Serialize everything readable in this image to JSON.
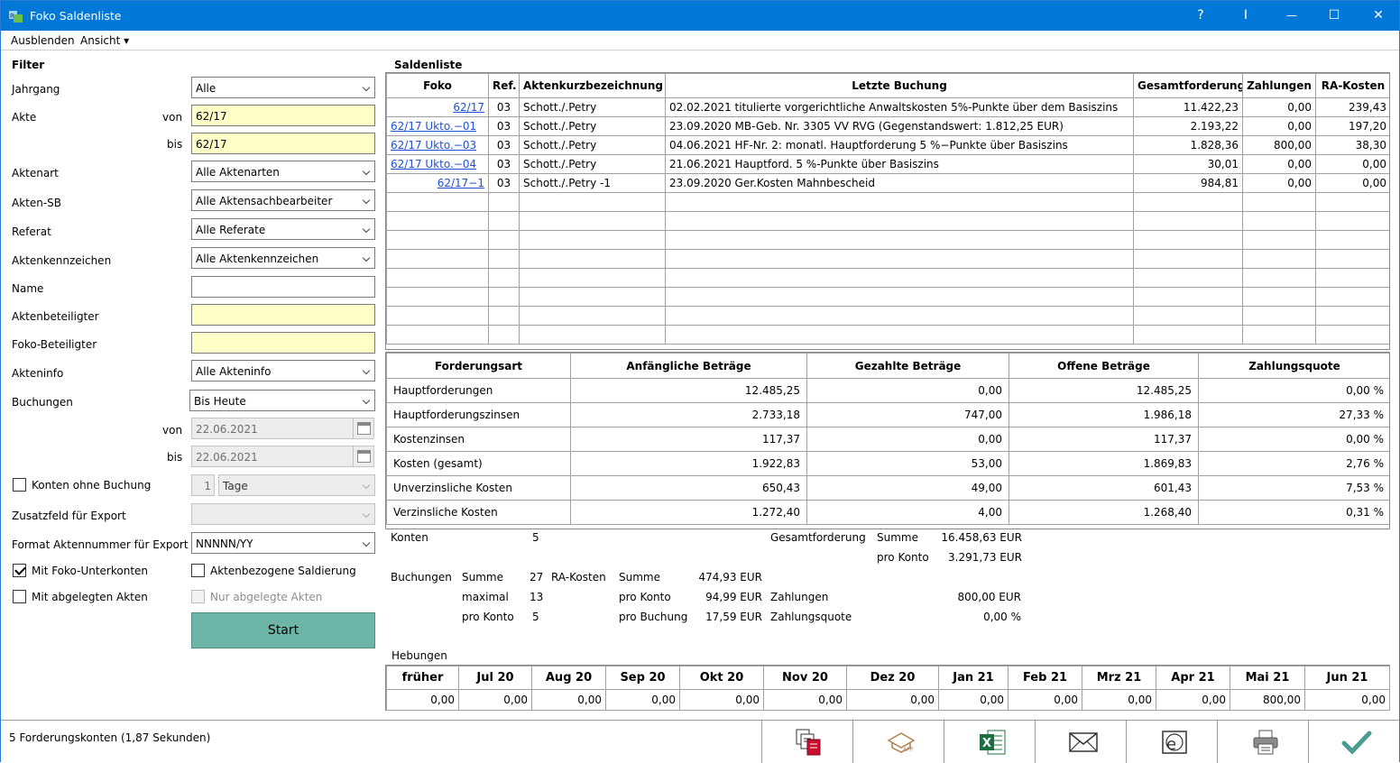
{
  "window": {
    "title": "Foko Saldenliste"
  },
  "title_buttons": {
    "help": "?",
    "pin": "I",
    "minimize": "—",
    "maximize": "☐",
    "close": "✕"
  },
  "menu": {
    "hide": "Ausblenden",
    "view": "Ansicht ▾"
  },
  "filter": {
    "title": "Filter",
    "jahrgang": {
      "label": "Jahrgang",
      "value": "Alle"
    },
    "akte": {
      "label": "Akte",
      "von_label": "von",
      "von": "62/17",
      "bis_label": "bis",
      "bis": "62/17"
    },
    "aktenart": {
      "label": "Aktenart",
      "value": "Alle Aktenarten"
    },
    "aktensb": {
      "label": "Akten-SB",
      "value": "Alle Aktensachbearbeiter"
    },
    "referat": {
      "label": "Referat",
      "value": "Alle Referate"
    },
    "aktenkennzeichen": {
      "label": "Aktenkennzeichen",
      "value": "Alle Aktenkennzeichen"
    },
    "name": {
      "label": "Name",
      "value": ""
    },
    "aktenbeteiligter": {
      "label": "Aktenbeteiligter",
      "value": ""
    },
    "fokobeteiligter": {
      "label": "Foko-Beteiligter",
      "value": ""
    },
    "akteninfo": {
      "label": "Akteninfo",
      "value": "Alle Akteninfo"
    },
    "buchungen": {
      "label": "Buchungen",
      "value": "Bis Heute",
      "von_label": "von",
      "von": "22.06.2021",
      "bis_label": "bis",
      "bis": "22.06.2021"
    },
    "konten_ohne_buchung": {
      "label": "Konten ohne Buchung",
      "number": "1",
      "unit": "Tage"
    },
    "zusatzfeld": {
      "label": "Zusatzfeld für Export",
      "value": ""
    },
    "format": {
      "label": "Format Aktennummer für Export",
      "value": "NNNNN/YY"
    },
    "mit_unterkonten": {
      "label": "Mit Foko-Unterkonten"
    },
    "aktenbezogen": {
      "label": "Aktenbezogene Saldierung"
    },
    "mit_abgelegten": {
      "label": "Mit abgelegten Akten"
    },
    "nur_abgelegte": {
      "label": "Nur abgelegte Akten"
    },
    "start": "Start"
  },
  "saldenliste": {
    "title": "Saldenliste",
    "headers": [
      "Foko",
      "Ref.",
      "Aktenkurzbezeichnung",
      "Letzte Buchung",
      "Gesamtforderung",
      "Zahlungen",
      "RA-Kosten"
    ],
    "rows": [
      {
        "foko": "62/17",
        "ref": "03",
        "bez": "Schott./.Petry",
        "buchung": "02.02.2021 titulierte vorgerichtliche Anwaltskosten 5%-Punkte über dem Basiszins",
        "gesamt": "11.422,23",
        "zahlungen": "0,00",
        "ra": "239,43"
      },
      {
        "foko": "62/17 Ukto.−01",
        "ref": "03",
        "bez": "Schott./.Petry",
        "buchung": "23.09.2020 MB-Geb. Nr. 3305 VV RVG (Gegenstandswert: 1.812,25 EUR)",
        "gesamt": "2.193,22",
        "zahlungen": "0,00",
        "ra": "197,20"
      },
      {
        "foko": "62/17 Ukto.−03",
        "ref": "03",
        "bez": "Schott./.Petry",
        "buchung": "04.06.2021 HF-Nr. 2: monatl. Hauptforderung 5 %−Punkte über Basiszins",
        "gesamt": "1.828,36",
        "zahlungen": "800,00",
        "ra": "38,30"
      },
      {
        "foko": "62/17 Ukto.−04",
        "ref": "03",
        "bez": "Schott./.Petry",
        "buchung": "21.06.2021 Hauptford. 5 %-Punkte über Basiszins",
        "gesamt": "30,01",
        "zahlungen": "0,00",
        "ra": "0,00"
      },
      {
        "foko": "62/17−1",
        "ref": "03",
        "bez": "Schott./.Petry -1",
        "buchung": "23.09.2020 Ger.Kosten Mahnbescheid",
        "gesamt": "984,81",
        "zahlungen": "0,00",
        "ra": "0,00"
      }
    ]
  },
  "forderungen": {
    "headers": [
      "Forderungsart",
      "Anfängliche Beträge",
      "Gezahlte Beträge",
      "Offene Beträge",
      "Zahlungsquote"
    ],
    "rows": [
      {
        "art": "Hauptforderungen",
        "anf": "12.485,25",
        "gez": "0,00",
        "off": "12.485,25",
        "quote": "0,00 %"
      },
      {
        "art": "Hauptforderungszinsen",
        "anf": "2.733,18",
        "gez": "747,00",
        "off": "1.986,18",
        "quote": "27,33 %"
      },
      {
        "art": "Kostenzinsen",
        "anf": "117,37",
        "gez": "0,00",
        "off": "117,37",
        "quote": "0,00 %"
      },
      {
        "art": "Kosten (gesamt)",
        "anf": "1.922,83",
        "gez": "53,00",
        "off": "1.869,83",
        "quote": "2,76 %"
      },
      {
        "art": "Unverzinsliche Kosten",
        "anf": "650,43",
        "gez": "49,00",
        "off": "601,43",
        "quote": "7,53 %"
      },
      {
        "art": "Verzinsliche Kosten",
        "anf": "1.272,40",
        "gez": "4,00",
        "off": "1.268,40",
        "quote": "0,31 %"
      }
    ]
  },
  "summary": {
    "konten_label": "Konten",
    "konten": "5",
    "gesamt_label": "Gesamtforderung",
    "summe_label": "Summe",
    "gesamt_summe": "16.458,63 EUR",
    "pro_konto_label": "pro Konto",
    "gesamt_pro_konto": "3.291,73 EUR",
    "buchungen_label": "Buchungen",
    "buch_summe_label": "Summe",
    "buch_summe": "27",
    "maximal_label": "maximal",
    "buch_max": "13",
    "buch_pro_konto_label": "pro Konto",
    "buch_pro_konto": "5",
    "ra_label": "RA-Kosten",
    "ra_summe_label": "Summe",
    "ra_summe": "474,93 EUR",
    "ra_pro_konto_label": "pro Konto",
    "ra_pro_konto": "94,99 EUR",
    "ra_pro_buchung_label": "pro Buchung",
    "ra_pro_buchung": "17,59 EUR",
    "zahlungen_label": "Zahlungen",
    "zahlungen": "800,00 EUR",
    "quote_label": "Zahlungsquote",
    "quote": "0,00 %",
    "hebungen_label": "Hebungen"
  },
  "hebungen": {
    "headers": [
      "früher",
      "Jul 20",
      "Aug 20",
      "Sep 20",
      "Okt 20",
      "Nov 20",
      "Dez 20",
      "Jan 21",
      "Feb 21",
      "Mrz 21",
      "Apr 21",
      "Mai 21",
      "Jun 21"
    ],
    "values": [
      "0,00",
      "0,00",
      "0,00",
      "0,00",
      "0,00",
      "0,00",
      "0,00",
      "0,00",
      "0,00",
      "0,00",
      "0,00",
      "800,00",
      "0,00"
    ]
  },
  "status": {
    "text": "5 Forderungskonten (1,87 Sekunden)"
  },
  "toolbar": [
    "copy-icon",
    "dms-icon",
    "excel-icon",
    "mail-icon",
    "email-icon",
    "print-icon",
    "check-icon"
  ]
}
